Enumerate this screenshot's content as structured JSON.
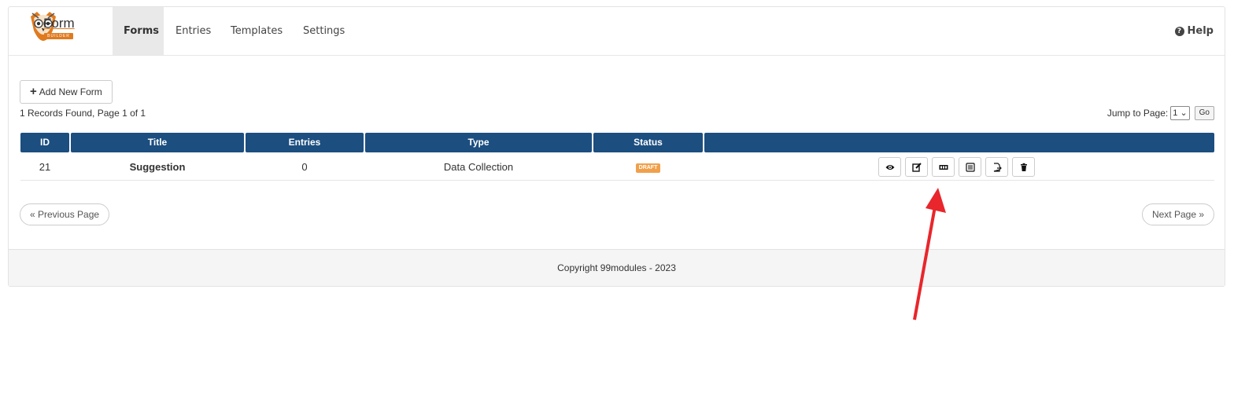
{
  "app": {
    "logo_text": "Form",
    "logo_sub": "BUILDER"
  },
  "nav": {
    "items": [
      {
        "label": "Forms",
        "active": true
      },
      {
        "label": "Entries"
      },
      {
        "label": "Templates"
      },
      {
        "label": "Settings"
      }
    ],
    "help_label": "Help"
  },
  "toolbar": {
    "add_label": "Add New Form"
  },
  "records": {
    "summary": "1 Records Found, Page 1 of 1"
  },
  "jump": {
    "label": "Jump to Page:",
    "selected": "1",
    "go_label": "Go"
  },
  "table": {
    "columns": [
      "ID",
      "Title",
      "Entries",
      "Type",
      "Status",
      ""
    ],
    "rows": [
      {
        "id": "21",
        "title": "Suggestion",
        "entries": "0",
        "type": "Data Collection",
        "status": "DRAFT"
      }
    ],
    "actions": [
      "eye-icon",
      "edit-icon",
      "shortcode-icon",
      "list-icon",
      "export-icon",
      "trash-icon"
    ]
  },
  "pager": {
    "prev_label": "« Previous Page",
    "next_label": "Next Page »"
  },
  "footer": {
    "copyright": "Copyright 99modules - 2023"
  },
  "colors": {
    "header_bg": "#1c4e80",
    "accent": "#e07a1f",
    "badge": "#f0a04b",
    "arrow": "#e8262b"
  }
}
